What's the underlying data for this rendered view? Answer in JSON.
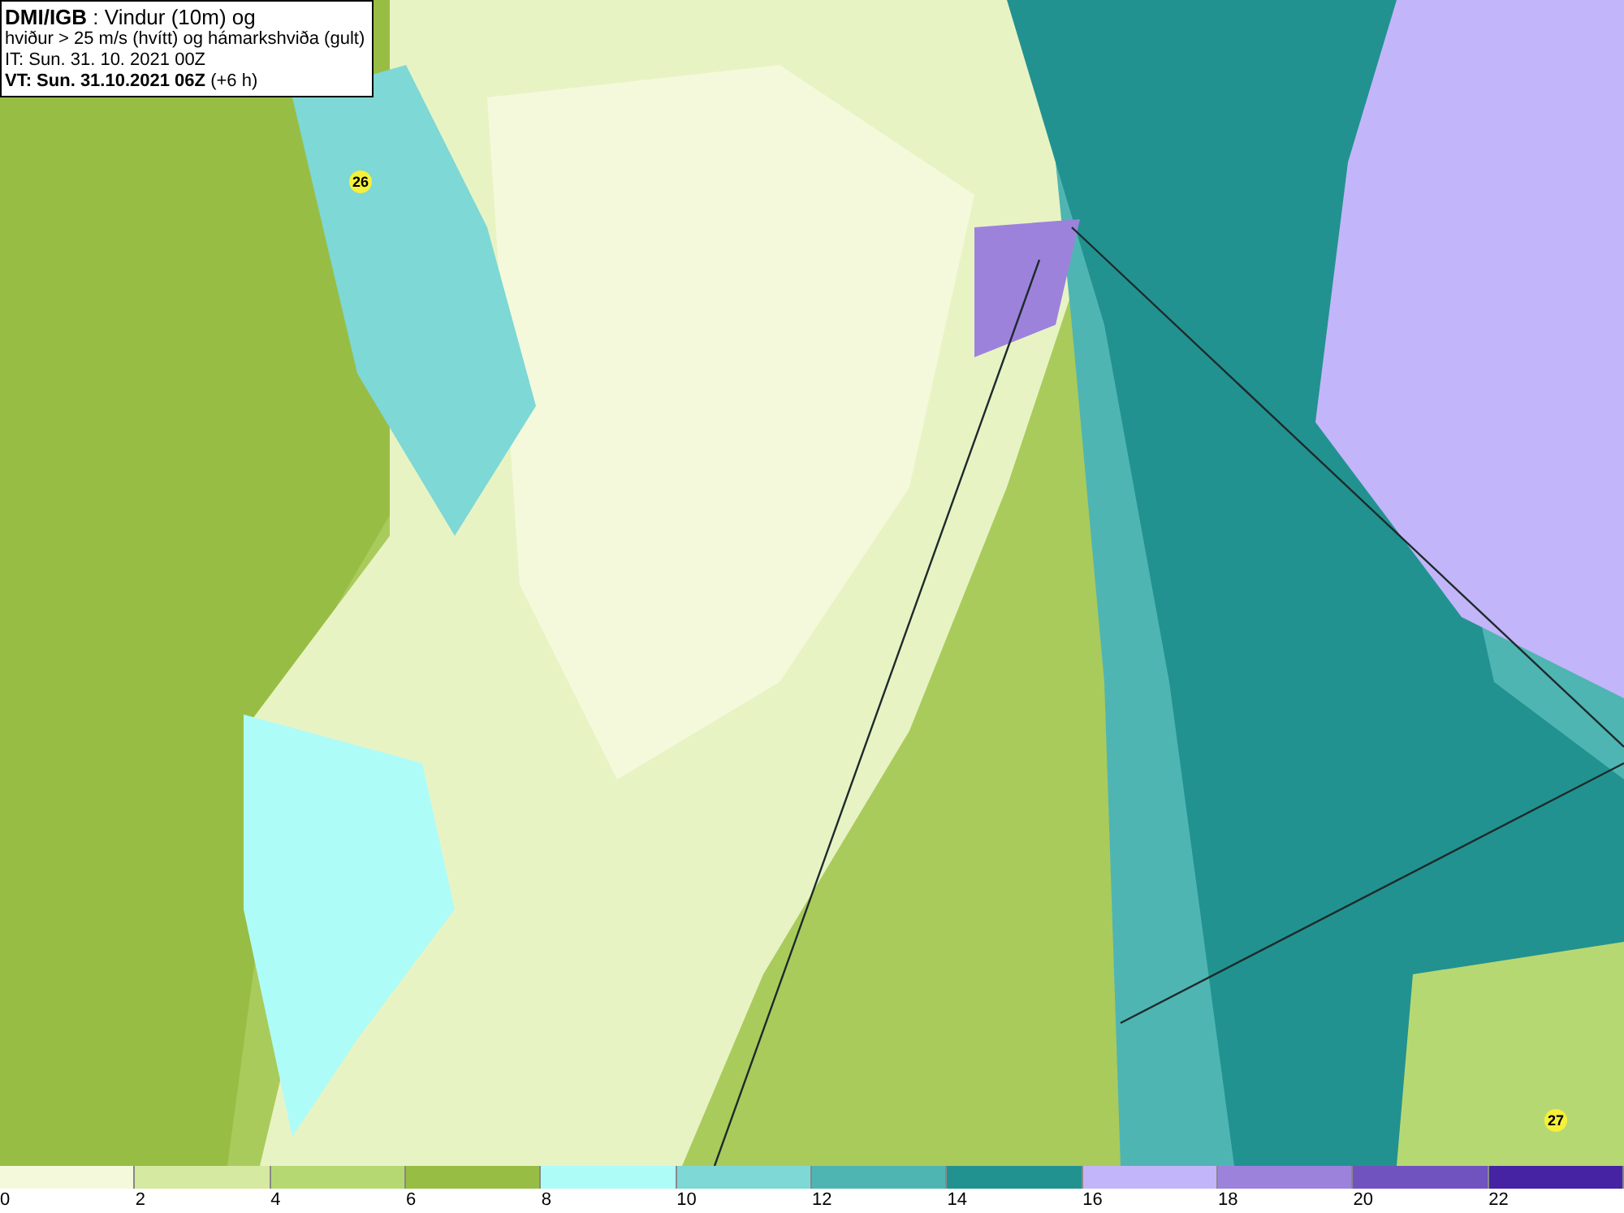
{
  "title_box": {
    "source": "DMI/IGB",
    "line_1": " : Vindur (10m) og",
    "line_2": "hviður > 25 m/s (hvítt) og hámarkshviða (gult)",
    "line_3": "IT: Sun. 31. 10. 2021 00Z",
    "valid_time": "VT: Sun. 31.10.2021 06Z",
    "offset": " (+6 h)"
  },
  "map": {
    "markers": [
      {
        "value": "26"
      },
      {
        "value": "27"
      }
    ]
  },
  "legend": {
    "bins": [
      {
        "color": "#f4f9dc"
      },
      {
        "color": "#d6e9a0"
      },
      {
        "color": "#b6d873"
      },
      {
        "color": "#98bd44"
      },
      {
        "color": "#aefcf8"
      },
      {
        "color": "#7dd8d6"
      },
      {
        "color": "#4fb5b3"
      },
      {
        "color": "#229290"
      },
      {
        "color": "#c3b5f9"
      },
      {
        "color": "#9d82dc"
      },
      {
        "color": "#7053bf"
      },
      {
        "color": "#4623a3"
      }
    ],
    "ticks": [
      "0",
      "2",
      "4",
      "6",
      "8",
      "10",
      "12",
      "14",
      "16",
      "18",
      "20",
      "22"
    ]
  }
}
